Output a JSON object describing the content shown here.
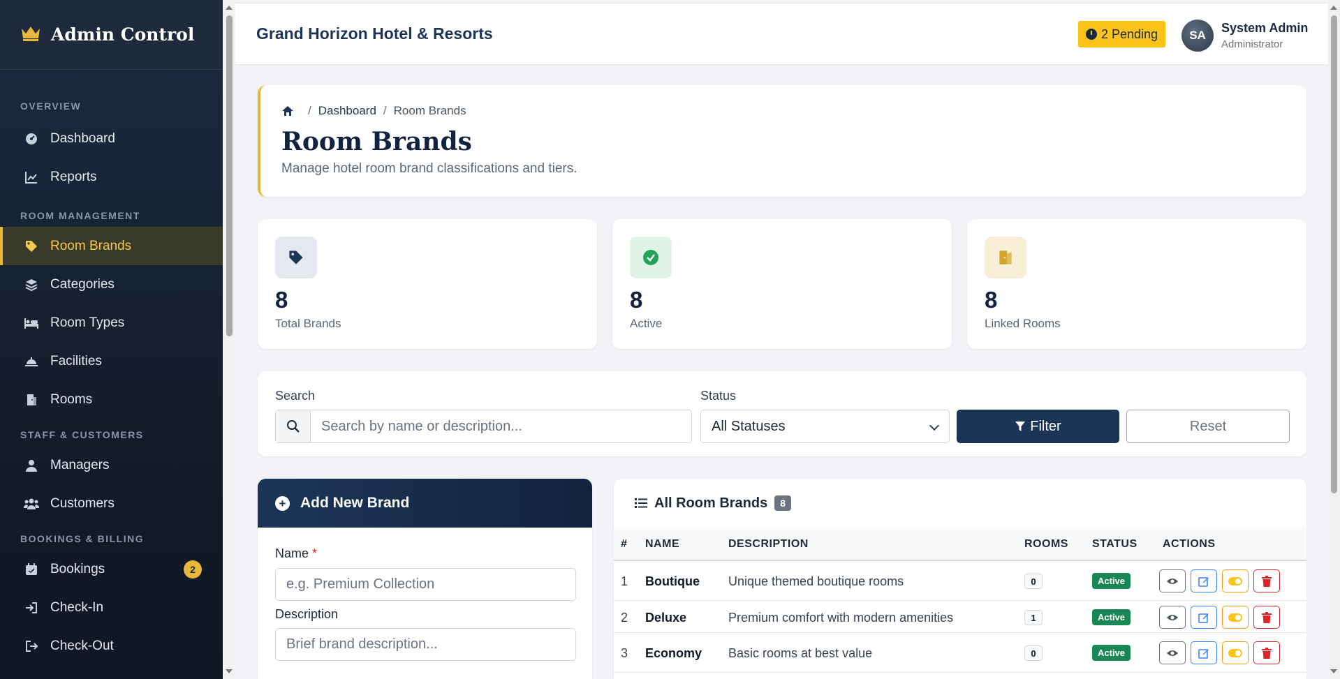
{
  "sidebar": {
    "brand": "Admin Control",
    "sections": [
      {
        "label": "OVERVIEW",
        "items": [
          {
            "label": "Dashboard",
            "icon": "gauge-icon"
          },
          {
            "label": "Reports",
            "icon": "chart-line-icon"
          }
        ]
      },
      {
        "label": "ROOM MANAGEMENT",
        "items": [
          {
            "label": "Room Brands",
            "icon": "tag-icon",
            "active": true
          },
          {
            "label": "Categories",
            "icon": "layers-icon"
          },
          {
            "label": "Room Types",
            "icon": "bed-icon"
          },
          {
            "label": "Facilities",
            "icon": "bell-concierge-icon"
          },
          {
            "label": "Rooms",
            "icon": "door-icon"
          }
        ]
      },
      {
        "label": "STAFF & CUSTOMERS",
        "items": [
          {
            "label": "Managers",
            "icon": "user-icon"
          },
          {
            "label": "Customers",
            "icon": "users-icon"
          }
        ]
      },
      {
        "label": "BOOKINGS & BILLING",
        "items": [
          {
            "label": "Bookings",
            "icon": "calendar-icon",
            "badge": "2"
          },
          {
            "label": "Check-In",
            "icon": "sign-in-icon"
          },
          {
            "label": "Check-Out",
            "icon": "sign-out-icon"
          }
        ]
      }
    ]
  },
  "topbar": {
    "hotel_name": "Grand Horizon Hotel & Resorts",
    "pending_label": "2 Pending",
    "user_initials": "SA",
    "user_name": "System Admin",
    "user_role": "Administrator"
  },
  "header": {
    "breadcrumb_home_icon": "home-icon",
    "breadcrumb_link": "Dashboard",
    "breadcrumb_current": "Room Brands",
    "separator": "/",
    "title": "Room Brands",
    "subtitle": "Manage hotel room brand classifications and tiers."
  },
  "stats": [
    {
      "value": "8",
      "label": "Total Brands",
      "icon": "tag-icon"
    },
    {
      "value": "8",
      "label": "Active",
      "icon": "check-circle-icon"
    },
    {
      "value": "8",
      "label": "Linked Rooms",
      "icon": "door-open-icon"
    }
  ],
  "filters": {
    "search_label": "Search",
    "search_placeholder": "Search by name or description...",
    "status_label": "Status",
    "status_value": "All Statuses",
    "filter_button": "Filter",
    "reset_button": "Reset"
  },
  "add_form": {
    "title": "Add New Brand",
    "name_label": "Name",
    "required_mark": "*",
    "name_placeholder": "e.g. Premium Collection",
    "description_label": "Description",
    "description_placeholder": "Brief brand description..."
  },
  "list": {
    "title": "All Room Brands",
    "count": "8",
    "columns": [
      "#",
      "NAME",
      "DESCRIPTION",
      "ROOMS",
      "STATUS",
      "ACTIONS"
    ],
    "rows": [
      {
        "num": "1",
        "name": "Boutique",
        "description": "Unique themed boutique rooms",
        "rooms": "0",
        "status": "Active"
      },
      {
        "num": "2",
        "name": "Deluxe",
        "description": "Premium comfort with modern amenities",
        "rooms": "1",
        "status": "Active"
      },
      {
        "num": "3",
        "name": "Economy",
        "description": "Basic rooms at best value",
        "rooms": "0",
        "status": "Active"
      }
    ]
  },
  "colors": {
    "navy": "#1c3557",
    "gold": "#e8b73a",
    "success": "#198754",
    "danger": "#dc2626",
    "warning": "#fcc419"
  }
}
